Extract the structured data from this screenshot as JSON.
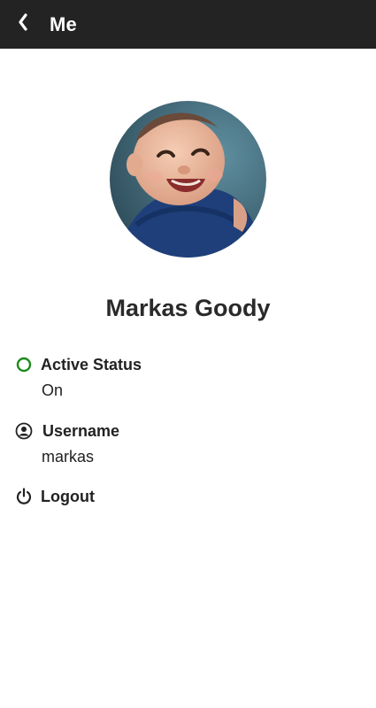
{
  "header": {
    "title": "Me",
    "back_icon": "chevron-left-icon"
  },
  "profile": {
    "name": "Markas Goody",
    "avatar": "profile-photo"
  },
  "items": [
    {
      "label": "Active Status",
      "value": "On",
      "icon": "status-circle-icon",
      "icon_color": "#1b8a1b"
    },
    {
      "label": "Username",
      "value": "markas",
      "icon": "account-circle-icon"
    },
    {
      "label": "Logout",
      "icon": "power-icon"
    }
  ],
  "colors": {
    "topbar": "#232323",
    "status_active": "#1b8a1b"
  }
}
